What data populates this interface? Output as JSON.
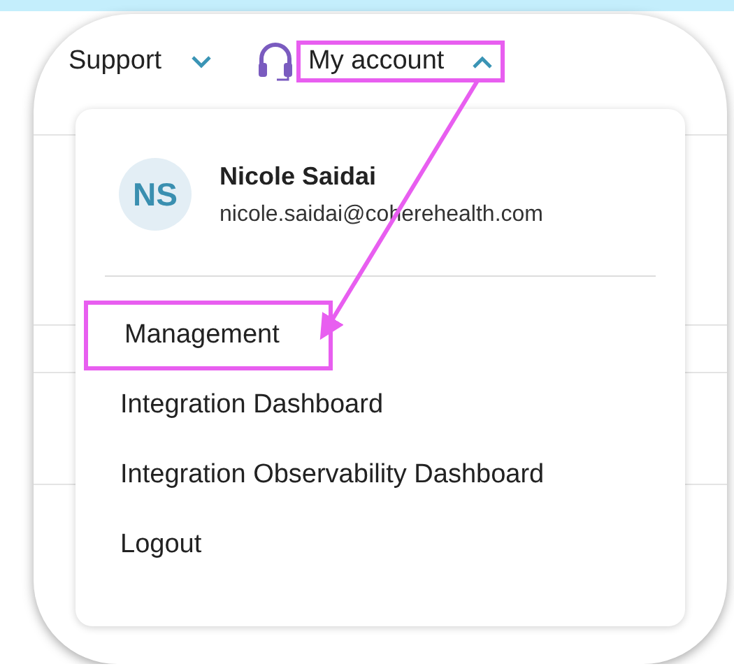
{
  "header": {
    "support": {
      "label": "Support",
      "expanded": false
    },
    "account": {
      "label": "My account",
      "expanded": true,
      "highlighted": true
    }
  },
  "account_menu": {
    "user": {
      "initials": "NS",
      "name": "Nicole Saidai",
      "email": "nicole.saidai@coherehealth.com"
    },
    "items": [
      {
        "label": "Management",
        "highlighted": true
      },
      {
        "label": "Integration Dashboard",
        "highlighted": false
      },
      {
        "label": "Integration Observability Dashboard",
        "highlighted": false
      },
      {
        "label": "Logout",
        "highlighted": false
      }
    ]
  },
  "annotation": {
    "arrow": true
  }
}
